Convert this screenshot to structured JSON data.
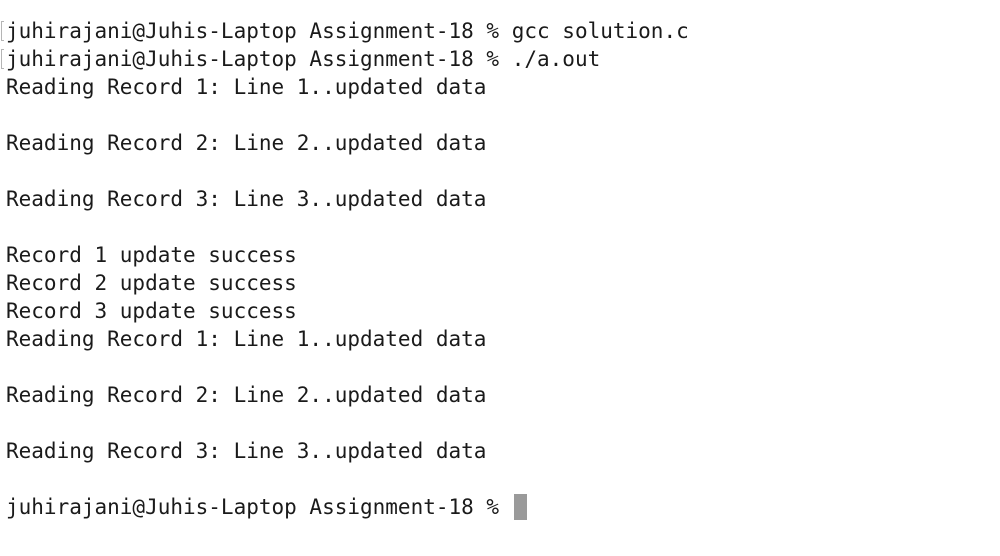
{
  "terminal": {
    "lines": [
      "juhirajani@Juhis-Laptop Assignment-18 % gcc solution.c",
      "juhirajani@Juhis-Laptop Assignment-18 % ./a.out",
      "Reading Record 1: Line 1..updated data",
      "",
      "Reading Record 2: Line 2..updated data",
      "",
      "Reading Record 3: Line 3..updated data",
      "",
      "Record 1 update success",
      "Record 2 update success",
      "Record 3 update success",
      "Reading Record 1: Line 1..updated data",
      "",
      "Reading Record 2: Line 2..updated data",
      "",
      "Reading Record 3: Line 3..updated data",
      "",
      "juhirajani@Juhis-Laptop Assignment-18 %"
    ]
  }
}
